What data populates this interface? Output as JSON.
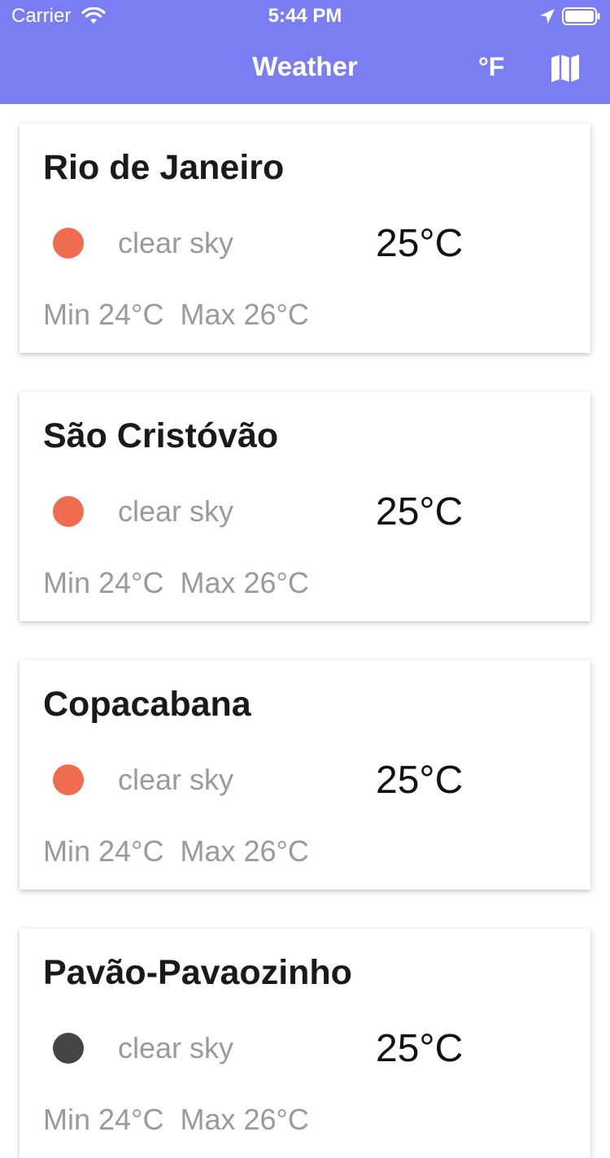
{
  "status_bar": {
    "carrier": "Carrier",
    "time": "5:44 PM",
    "icons": [
      "wifi-icon",
      "location-icon",
      "battery-icon"
    ]
  },
  "header": {
    "title": "Weather",
    "unit_toggle": "°F",
    "map_icon": "map-icon",
    "background": "#7a7ef2"
  },
  "cards": [
    {
      "city": "Rio de Janeiro",
      "description": "clear sky",
      "temp": "25°C",
      "min": "Min 24°C",
      "max": "Max 26°C",
      "dot_color": "#ef6c4e"
    },
    {
      "city": "São Cristóvão",
      "description": "clear sky",
      "temp": "25°C",
      "min": "Min 24°C",
      "max": "Max 26°C",
      "dot_color": "#ef6c4e"
    },
    {
      "city": "Copacabana",
      "description": "clear sky",
      "temp": "25°C",
      "min": "Min 24°C",
      "max": "Max 26°C",
      "dot_color": "#ef6c4e"
    },
    {
      "city": "Pavão-Pavaozinho",
      "description": "clear sky",
      "temp": "25°C",
      "min": "Min 24°C",
      "max": "Max 26°C",
      "dot_color": "#444444"
    }
  ]
}
